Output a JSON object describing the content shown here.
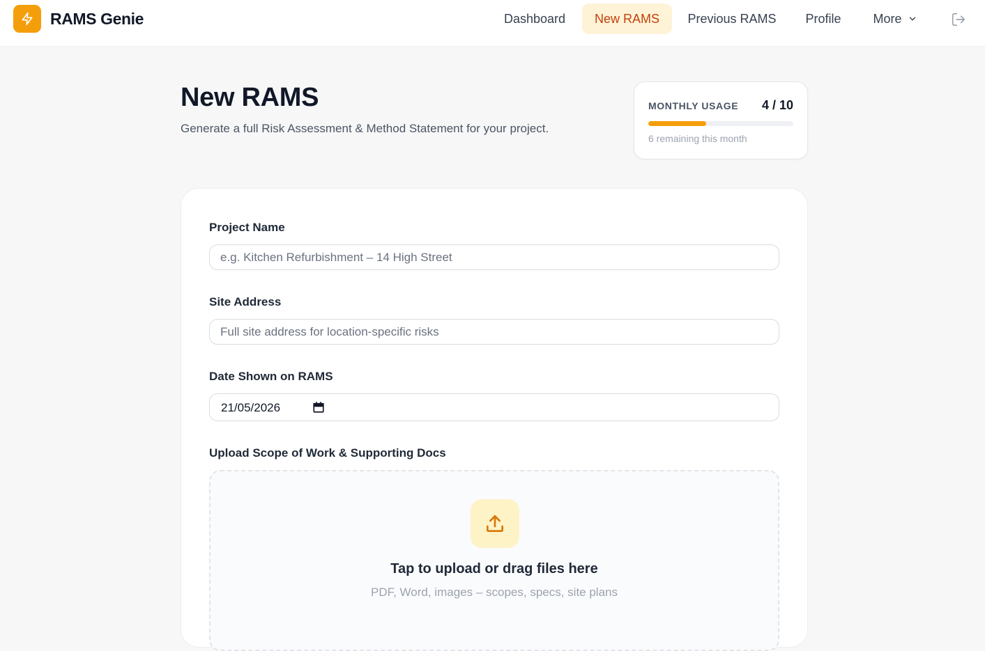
{
  "app": {
    "name": "RAMS Genie"
  },
  "nav": {
    "items": [
      {
        "label": "Dashboard",
        "active": false
      },
      {
        "label": "New RAMS",
        "active": true
      },
      {
        "label": "Previous RAMS",
        "active": false
      },
      {
        "label": "Profile",
        "active": false
      },
      {
        "label": "More",
        "active": false
      }
    ],
    "icons": {
      "logo": "lightning-icon",
      "more": "chevron-down-icon",
      "logout": "logout-icon"
    }
  },
  "page": {
    "title": "New RAMS",
    "subtitle": "Generate a full Risk Assessment & Method Statement for your project."
  },
  "usage": {
    "label": "MONTHLY USAGE",
    "count_text": "4 / 10",
    "used": 4,
    "limit": 10,
    "remaining_text": "6 remaining this month"
  },
  "form": {
    "project_name": {
      "label": "Project Name",
      "value": "",
      "placeholder": "e.g. Kitchen Refurbishment – 14 High Street"
    },
    "site_address": {
      "label": "Site Address",
      "value": "",
      "placeholder": "Full site address for location-specific risks"
    },
    "date": {
      "label": "Date Shown on RAMS",
      "value": "21/05/2026"
    },
    "upload": {
      "label": "Upload Scope of Work & Supporting Docs",
      "title": "Tap to upload or drag files here",
      "subtitle": "PDF, Word, images – scopes, specs, site plans"
    }
  },
  "colors": {
    "accent": "#f59e0b",
    "accent_soft": "#fef3c7",
    "active_text": "#c2410c"
  }
}
